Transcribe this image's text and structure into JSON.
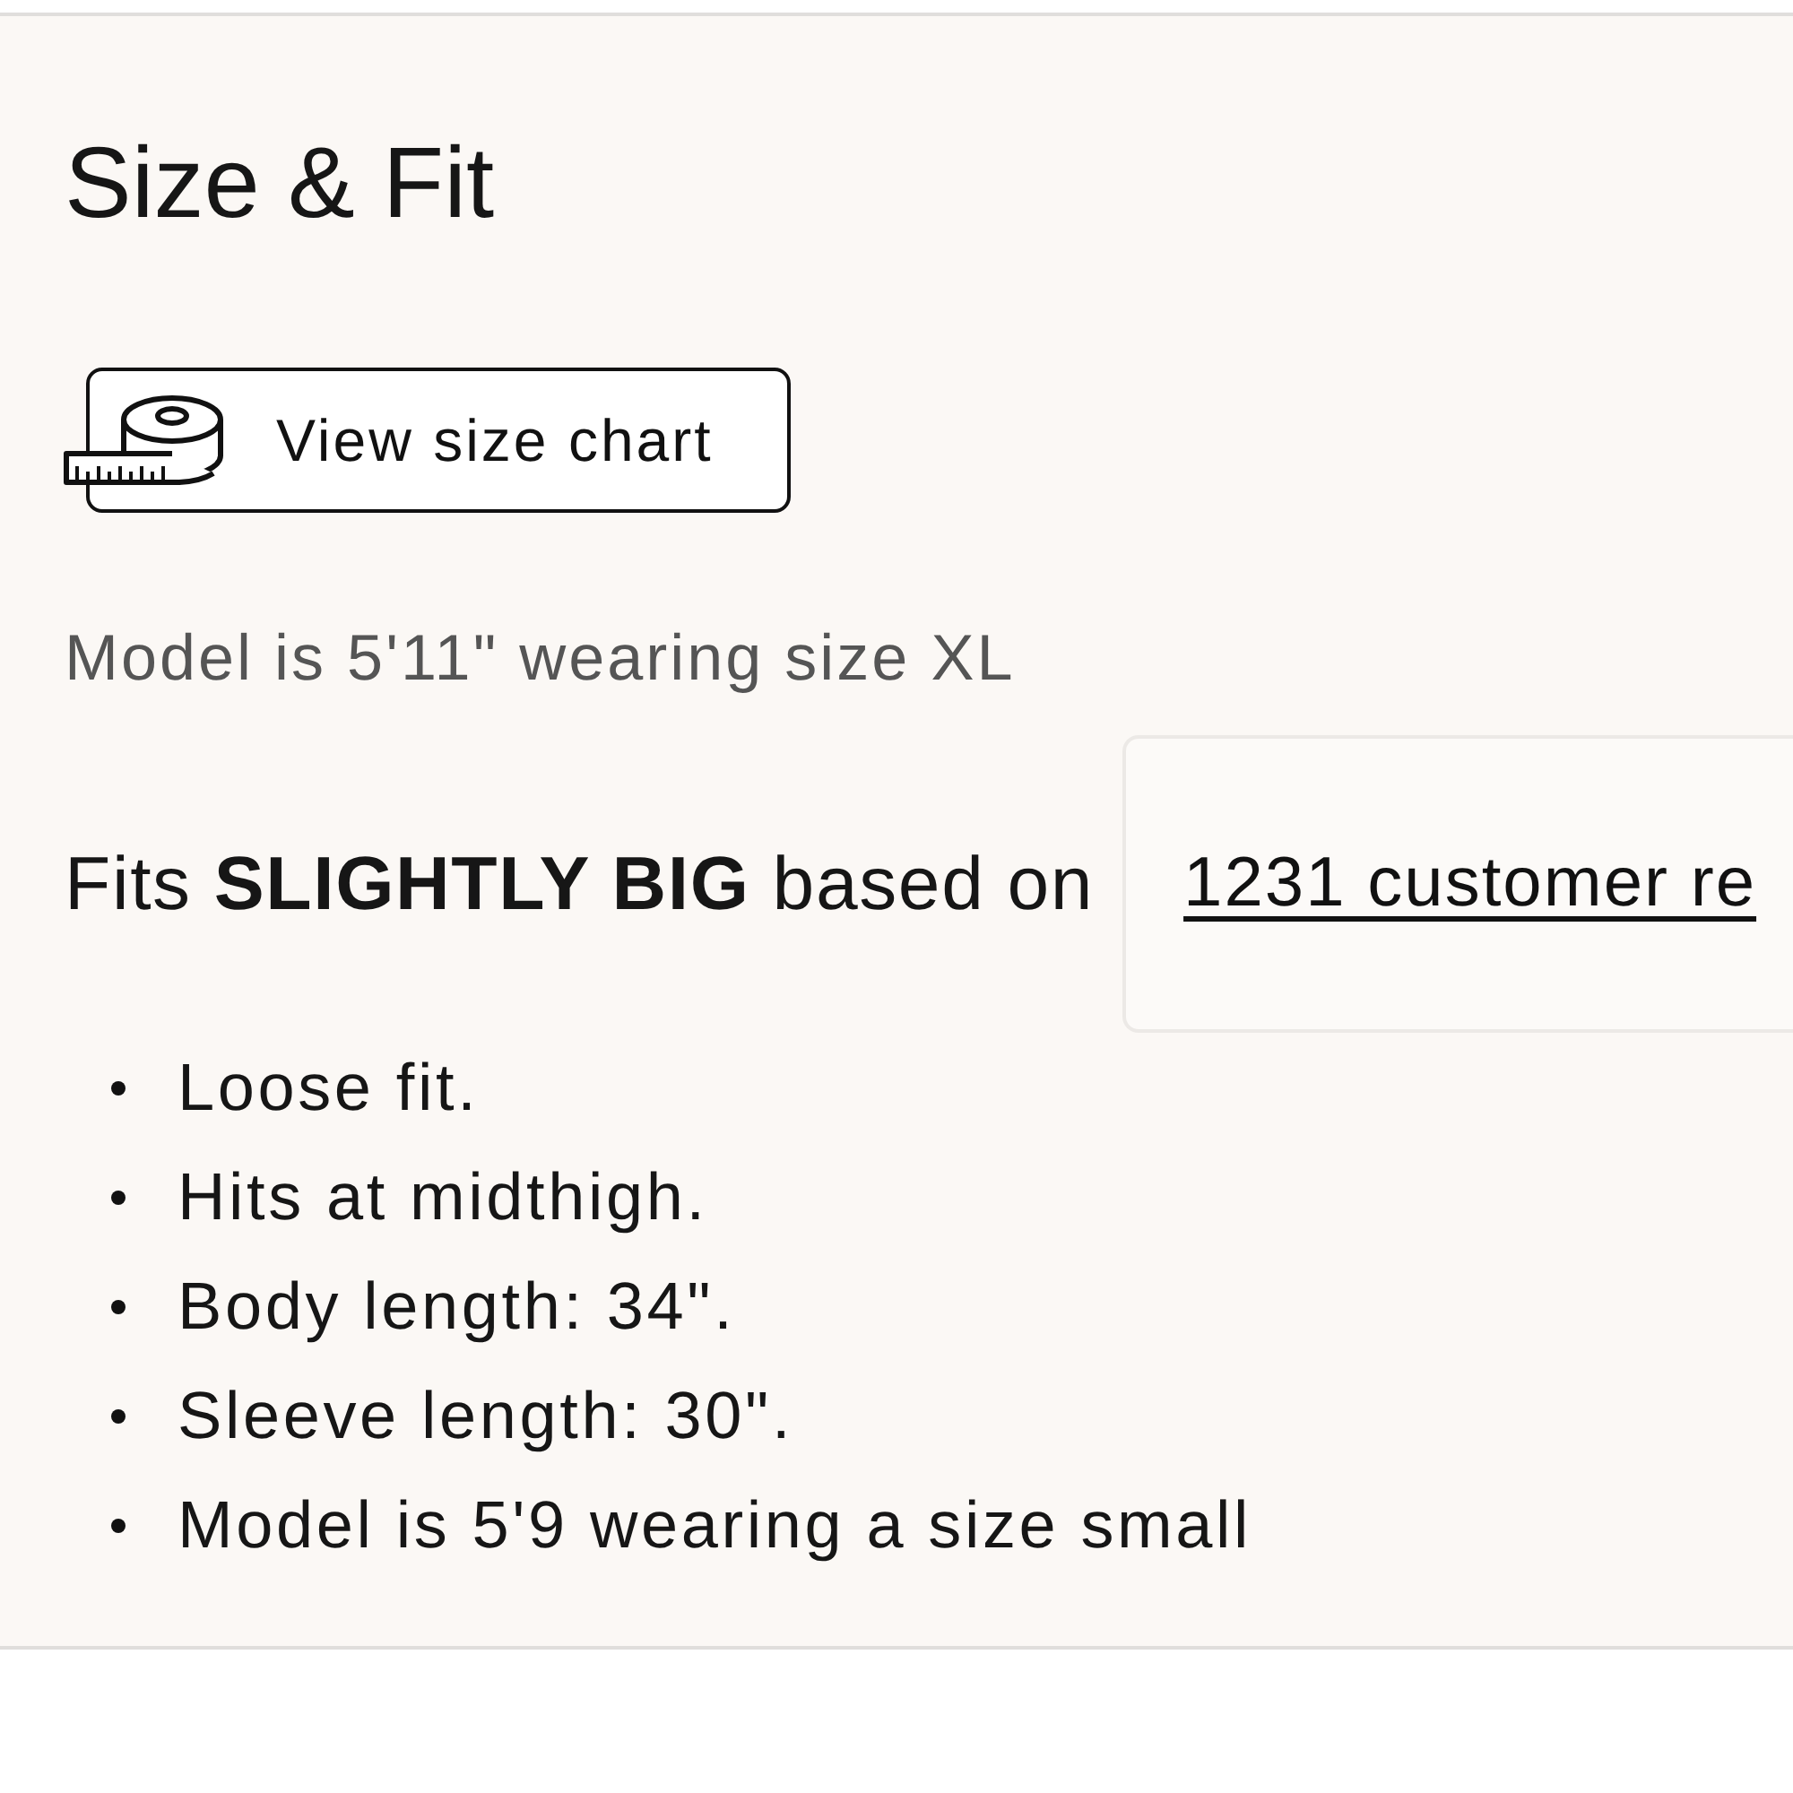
{
  "section": {
    "title": "Size & Fit"
  },
  "size_chart_button": {
    "label": "View size chart"
  },
  "model_note": "Model is 5'11\" wearing size XL",
  "fit_summary": {
    "text": "Fits **SLIGHTLY BIG** based on",
    "reviews_link": "1231 customer re"
  },
  "details": [
    "Loose fit.",
    "Hits at midthigh.",
    "Body length: 34\".",
    "Sleeve length: 30\".",
    "Model is 5'9 wearing a size small"
  ]
}
